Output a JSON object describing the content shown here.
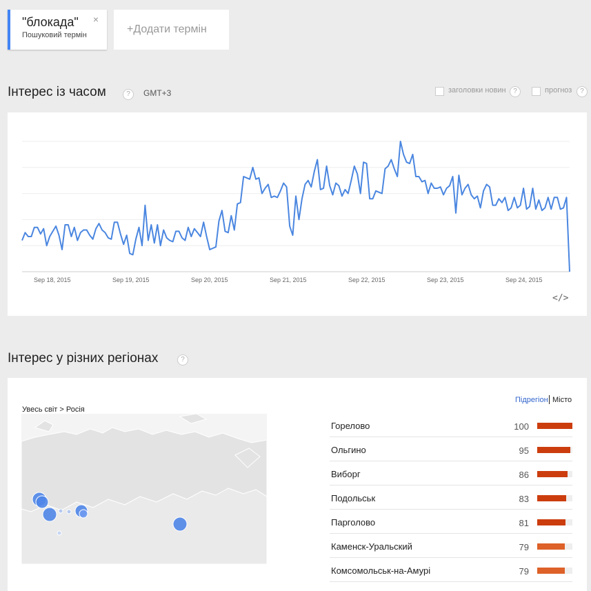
{
  "search_term": {
    "name": "\"блокада\"",
    "type": "Пошуковий термін",
    "close": "×"
  },
  "add_term": {
    "label": "+Додати термін"
  },
  "interest_over_time": {
    "title": "Інтерес із часом",
    "help": "?",
    "timezone": "GMT+3",
    "news_headlines": "заголовки новин",
    "forecast": "прогноз",
    "embed": "</>"
  },
  "chart_data": {
    "type": "line",
    "title": "",
    "xlabel": "",
    "ylabel": "",
    "x_ticks": [
      "Sep 18, 2015",
      "Sep 19, 2015",
      "Sep 20, 2015",
      "Sep 21, 2015",
      "Sep 22, 2015",
      "Sep 23, 2015",
      "Sep 24, 2015"
    ],
    "x_range": [
      "Sep 17, 2015 18:00",
      "Sep 25, 2015 02:00"
    ],
    "ylim": [
      0,
      100
    ],
    "grid": true,
    "series": [
      {
        "color": "#4a86e0",
        "values": [
          24,
          30,
          27,
          27,
          34,
          34,
          29,
          33,
          20,
          27,
          31,
          35,
          28,
          17,
          36,
          36,
          27,
          34,
          24,
          30,
          32,
          32,
          28,
          25,
          33,
          37,
          32,
          30,
          26,
          25,
          38,
          38,
          29,
          21,
          28,
          14,
          13,
          25,
          34,
          20,
          51,
          24,
          36,
          22,
          36,
          20,
          32,
          26,
          24,
          23,
          31,
          31,
          26,
          24,
          34,
          27,
          33,
          30,
          27,
          38,
          27,
          17,
          18,
          19,
          39,
          47,
          31,
          30,
          43,
          32,
          52,
          53,
          73,
          72,
          71,
          80,
          71,
          72,
          60,
          64,
          67,
          57,
          58,
          57,
          62,
          68,
          65,
          35,
          28,
          58,
          40,
          56,
          67,
          70,
          65,
          77,
          86,
          63,
          64,
          81,
          66,
          59,
          68,
          66,
          58,
          63,
          60,
          70,
          81,
          75,
          60,
          84,
          83,
          56,
          56,
          62,
          61,
          60,
          79,
          81,
          86,
          79,
          73,
          100,
          90,
          84,
          83,
          90,
          73,
          73,
          69,
          70,
          60,
          68,
          64,
          64,
          65,
          59,
          64,
          66,
          73,
          45,
          74,
          59,
          64,
          67,
          59,
          56,
          58,
          49,
          62,
          67,
          65,
          51,
          51,
          56,
          53,
          57,
          47,
          49,
          57,
          49,
          51,
          64,
          48,
          50,
          64,
          48,
          55,
          47,
          49,
          57,
          48,
          57,
          57,
          48,
          49,
          57,
          0
        ]
      }
    ]
  },
  "interest_by_region": {
    "title": "Інтерес у різних регіонах",
    "help": "?",
    "breadcrumb": "Увесь світ > Росія",
    "mode_subregion": "Підрегіон",
    "mode_city": "Місто",
    "rows": [
      {
        "name": "Горелово",
        "value": 100,
        "color": "#cc3d0e"
      },
      {
        "name": "Ольгино",
        "value": 95,
        "color": "#cc3d0e"
      },
      {
        "name": "Виборг",
        "value": 86,
        "color": "#cc3d0e"
      },
      {
        "name": "Подольськ",
        "value": 83,
        "color": "#cc3d0e"
      },
      {
        "name": "Парголово",
        "value": 81,
        "color": "#cc3d0e"
      },
      {
        "name": "Каменск-Уральский",
        "value": 79,
        "color": "#dd6128"
      },
      {
        "name": "Комсомольськ-на-Амурі",
        "value": 79,
        "color": "#dd6128"
      }
    ]
  }
}
